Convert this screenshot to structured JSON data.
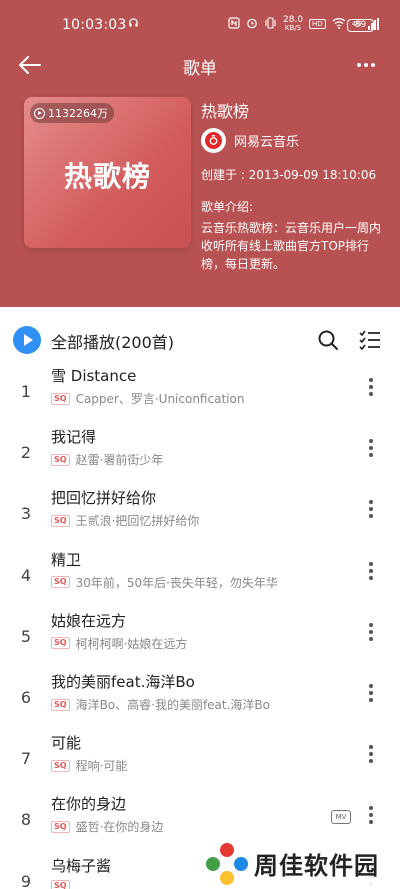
{
  "status_bar": {
    "time": "10:03:03",
    "net_speed_value": "28.0",
    "net_speed_unit": "KB/S",
    "hd_label": "HD",
    "signal_label": "4G",
    "battery": "89"
  },
  "header": {
    "title": "歌单"
  },
  "playlist": {
    "cover_title": "热歌榜",
    "play_count": "1132264万",
    "name": "热歌榜",
    "creator": "网易云音乐",
    "created": "创建于 : 2013-09-09 18:10:06",
    "description_label": "歌单介绍:",
    "description": "云音乐热歌榜：云音乐用户一周内收听所有线上歌曲官方TOP排行榜，每日更新。"
  },
  "controls": {
    "play_all": "全部播放(200首)"
  },
  "songs": [
    {
      "index": "1",
      "title": "雪 Distance",
      "quality": "SQ",
      "artist": "Capper、罗言·Uniconfication"
    },
    {
      "index": "2",
      "title": "我记得",
      "quality": "SQ",
      "artist": "赵雷·署前街少年"
    },
    {
      "index": "3",
      "title": "把回忆拼好给你",
      "quality": "SQ",
      "artist": "王贰浪·把回忆拼好给你"
    },
    {
      "index": "4",
      "title": "精卫",
      "quality": "SQ",
      "artist": "30年前，50年后·丧失年轻，勿失年华"
    },
    {
      "index": "5",
      "title": "姑娘在远方",
      "quality": "SQ",
      "artist": "柯柯柯啊·姑娘在远方"
    },
    {
      "index": "6",
      "title": "我的美丽feat.海洋Bo",
      "quality": "SQ",
      "artist": "海洋Bo、高睿·我的美丽feat.海洋Bo"
    },
    {
      "index": "7",
      "title": "可能",
      "quality": "SQ",
      "artist": "程响·可能"
    },
    {
      "index": "8",
      "title": "在你的身边",
      "quality": "SQ",
      "artist": "盛哲·在你的身边",
      "mv": "MV"
    },
    {
      "index": "9",
      "title": "乌梅子酱",
      "quality": "SQ",
      "artist": ""
    }
  ],
  "watermark": {
    "text": "周佳软件园"
  },
  "colors": {
    "hero_bg": "#b85252",
    "accent_blue": "#2f8ff2",
    "sq_red": "#e35b5b"
  }
}
